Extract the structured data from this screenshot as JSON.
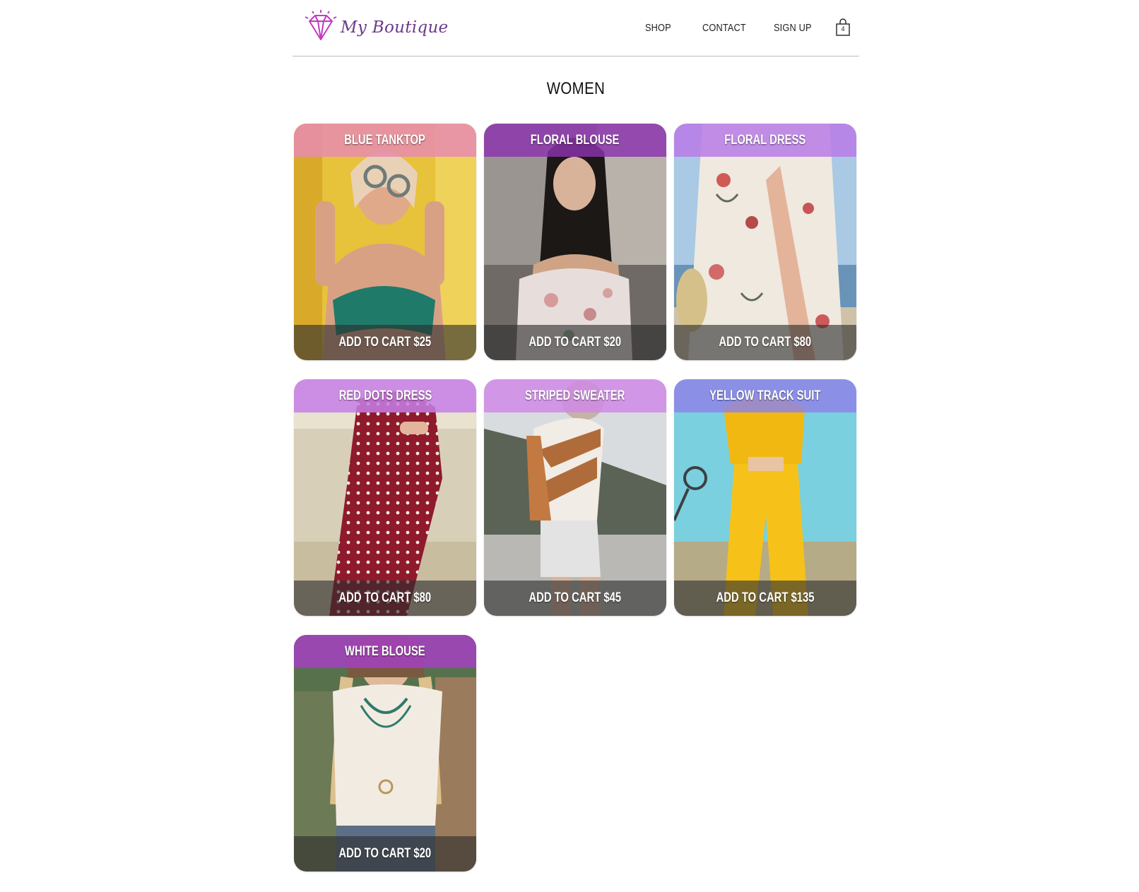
{
  "brand": {
    "name": "My Boutique",
    "logo_icon": "diamond-icon",
    "accent": "#c23bbf"
  },
  "nav": {
    "shop": "SHOP",
    "contact": "CONTACT",
    "signup": "SIGN UP",
    "cart_icon": "shopping-bag-icon",
    "cart_count": "4"
  },
  "page": {
    "title": "WOMEN"
  },
  "products": [
    {
      "name": "BLUE TANKTOP",
      "cart_label": "ADD TO CART $25",
      "band_color": "#e68cb0"
    },
    {
      "name": "FLORAL BLOUSE",
      "cart_label": "ADD TO CART $20",
      "band_color": "#9b3fbf"
    },
    {
      "name": "FLORAL DRESS",
      "cart_label": "ADD TO CART $80",
      "band_color": "#b87be8"
    },
    {
      "name": "RED DOTS DRESS",
      "cart_label": "ADD TO CART $80",
      "band_color": "#c77ee8"
    },
    {
      "name": "STRIPED SWEATER",
      "cart_label": "ADD TO CART $45",
      "band_color": "#d08ae8"
    },
    {
      "name": "YELLOW TRACK SUIT",
      "cart_label": "ADD TO CART $135",
      "band_color": "#8f84e8"
    },
    {
      "name": "WHITE BLOUSE",
      "cart_label": "ADD TO CART $20",
      "band_color": "#a640c4"
    }
  ]
}
